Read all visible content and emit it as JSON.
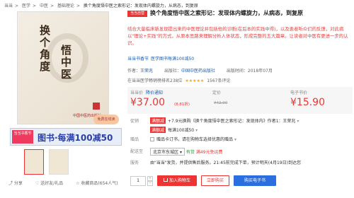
{
  "breadcrumb": [
    "当当",
    ">",
    "医学",
    ">",
    "中医",
    ">",
    "基础理论",
    ">",
    "换个角度悟中医之索形记：发现体内螺旋力，从病态，到复原"
  ],
  "left": {
    "cover_title_a": "换个角度",
    "cover_title_b": "悟中医",
    "cover_subtitle": "索形记",
    "cover_publisher": "中国中医药出版社",
    "free_badge": "免费在线读",
    "promo_tag": "当当书香节",
    "promo_text": "图书·每满100减50",
    "actions": [
      "分享",
      "送好友/礼品",
      "收藏商品(654人气)"
    ]
  },
  "product": {
    "self_badge": "当当自营",
    "title": "换个角度悟中医之索形记：发现体内螺旋力，从病态，到复原",
    "description": "结合大量临床新发现提出来的中医理论并包括他的诊断(在后本的实践中得)，以及患者听众们的反馈，对此病以\"理论+实践\"的方式，从原本思路来理解分析人体状态，形成完整的五大篇章。让读者对中医有更进一步的认识。",
    "sub_link_prefix": "当当书香节",
    "sub_link": "医学图书每满100减50"
  },
  "meta": {
    "author_label": "作者：",
    "author": "王荣兆",
    "publisher_label": "出版社：",
    "publisher": "中国中医药出版社",
    "date_label": "出版时间：",
    "date": "2018年07月"
  },
  "rating": {
    "rank_text": "在当当医学畅销榜排名238位",
    "stars": "★★★★★",
    "reviews": "1567条评论"
  },
  "price": {
    "dd_label": "当当价",
    "notice": "降价通知",
    "dd_price": "¥37.00",
    "discount": "(8.81折)",
    "list_label": "定价",
    "list_price": "¥42.00",
    "ebook_label": "电子书价",
    "ebook_price": "¥15.90"
  },
  "promo": {
    "label": "促销",
    "tag": "满额减",
    "text": "+7.9元换购《换个角度悟中医之索形记：发现体内》作者1：王荣兆",
    "more": "▾"
  },
  "combo": {
    "text": "每满100减50",
    "more": "▾"
  },
  "gift": {
    "label": "赠品",
    "text": "赠品卡订书，请在购物车选择优惠的赠品",
    "more": "▾"
  },
  "ship": {
    "label": "配送至",
    "city": "北京市东城区",
    "stock": "有货",
    "free": "满49元免运费",
    "more": "▾"
  },
  "service": {
    "label": "服务",
    "text": "由\"当当\"发货，并提供售后服务。21:45前完成下单，预计明天(4月19日)到达您"
  },
  "purchase": {
    "qty": "1",
    "cart": "加入购物车",
    "buy": "立即购买",
    "ebook": "购买电子书"
  }
}
